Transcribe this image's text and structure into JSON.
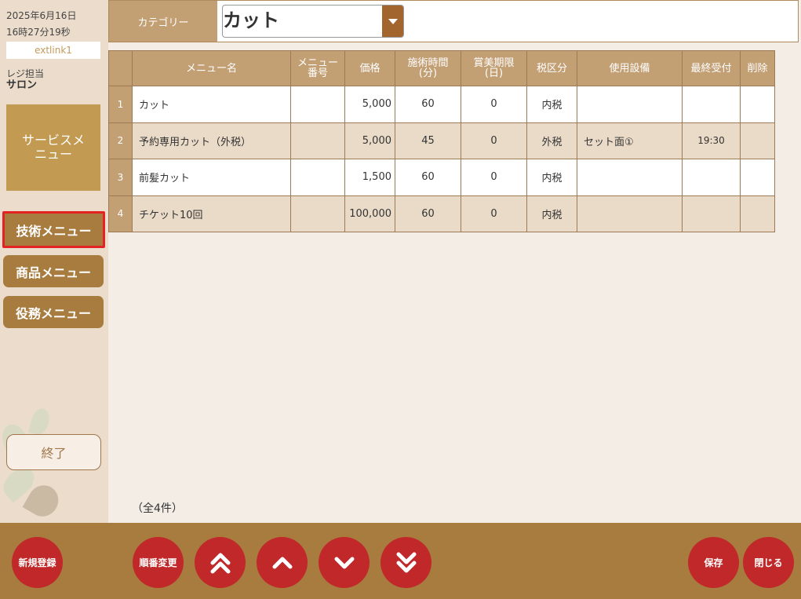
{
  "sidebar": {
    "date": "2025年6月16日",
    "time": "16時27分19秒",
    "user": "extlink1",
    "register_label": "レジ担当",
    "register_value": "サロン",
    "service_menu": "サービスメニュー",
    "tech_menu": "技術メニュー",
    "product_menu": "商品メニュー",
    "service_work_menu": "役務メニュー",
    "end": "終了"
  },
  "category": {
    "label": "カテゴリー",
    "value": "カット"
  },
  "table": {
    "headers": {
      "menu_name": "メニュー名",
      "menu_no_1": "メニュー",
      "menu_no_2": "番号",
      "price": "価格",
      "duration_1": "施術時間",
      "duration_2": "(分)",
      "expiry_1": "賞美期限",
      "expiry_2": "(日)",
      "tax": "税区分",
      "equipment": "使用設備",
      "last_accept": "最終受付",
      "delete": "削除"
    },
    "rows": [
      {
        "no": "1",
        "name": "カット",
        "menu_no": "",
        "price": "5,000",
        "duration": "60",
        "expiry": "0",
        "tax": "内税",
        "equipment": "",
        "last": "",
        "del": ""
      },
      {
        "no": "2",
        "name": "予約専用カット（外税）",
        "menu_no": "",
        "price": "5,000",
        "duration": "45",
        "expiry": "0",
        "tax": "外税",
        "equipment": "セット面①",
        "last": "19:30",
        "del": ""
      },
      {
        "no": "3",
        "name": "前髪カット",
        "menu_no": "",
        "price": "1,500",
        "duration": "60",
        "expiry": "0",
        "tax": "内税",
        "equipment": "",
        "last": "",
        "del": ""
      },
      {
        "no": "4",
        "name": "チケット10回",
        "menu_no": "",
        "price": "100,000",
        "duration": "60",
        "expiry": "0",
        "tax": "内税",
        "equipment": "",
        "last": "",
        "del": ""
      }
    ]
  },
  "total_text": "（全4件）",
  "footer": {
    "new": "新規登録",
    "order": "順番変更",
    "top_icon": "double-chevron-up-icon",
    "up_icon": "chevron-up-icon",
    "down_icon": "chevron-down-icon",
    "bottom_icon": "double-chevron-down-icon",
    "save": "保存",
    "close": "閉じる"
  },
  "colors": {
    "accent": "#a87b3f",
    "header": "#c39f74",
    "danger": "#c0282a",
    "highlight": "#e32222"
  }
}
